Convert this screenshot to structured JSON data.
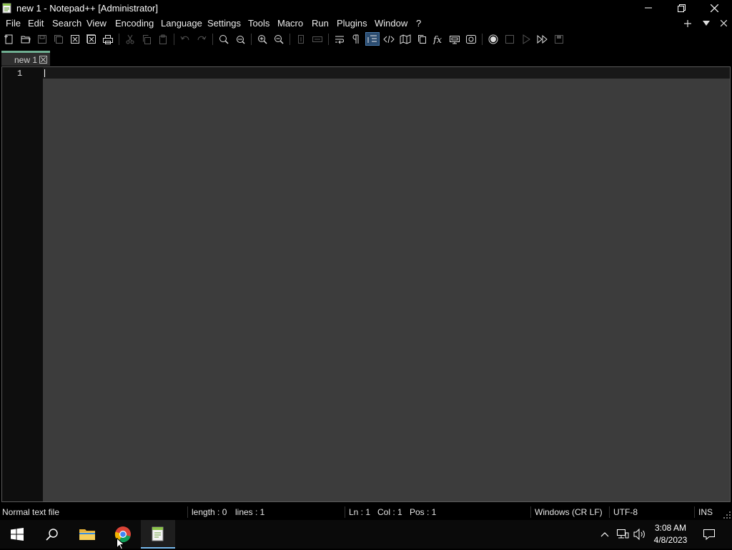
{
  "window": {
    "title": "new 1 - Notepad++ [Administrator]"
  },
  "menu": [
    "File",
    "Edit",
    "Search",
    "View",
    "Encoding",
    "Language",
    "Settings",
    "Tools",
    "Macro",
    "Run",
    "Plugins",
    "Window",
    "?"
  ],
  "toolbar": {
    "icons": [
      "new-file-icon",
      "open-file-icon",
      "save-icon",
      "save-all-icon",
      "close-icon",
      "close-all-icon",
      "print-icon",
      "cut-icon",
      "copy-icon",
      "paste-icon",
      "undo-icon",
      "redo-icon",
      "find-icon",
      "replace-icon",
      "zoom-in-icon",
      "zoom-out-icon",
      "sync-vertical-icon",
      "sync-horizontal-icon",
      "word-wrap-icon",
      "show-all-characters-icon",
      "indent-guide-icon",
      "language-icon",
      "document-map-icon",
      "document-list-icon",
      "function-list-icon",
      "folder-as-workspace-icon",
      "monitoring-icon",
      "record-macro-icon",
      "stop-recording-icon",
      "play-macro-icon",
      "run-macro-multiple-icon",
      "save-macro-icon"
    ]
  },
  "tab": {
    "label": "new 1"
  },
  "editor": {
    "line_number": "1",
    "content": ""
  },
  "status": {
    "file_type": "Normal text file",
    "length": "length : 0",
    "lines": "lines : 1",
    "ln": "Ln : 1",
    "col": "Col : 1",
    "pos": "Pos : 1",
    "eol": "Windows (CR LF)",
    "encoding": "UTF-8",
    "mode": "INS"
  },
  "taskbar": {
    "time": "3:08 AM",
    "date": "4/8/2023"
  },
  "colors": {
    "accent": "#6fae91",
    "editor_bg": "#3c3c3c",
    "gutter_bg": "#0e0e0e",
    "active_button": "#2b4c70"
  }
}
